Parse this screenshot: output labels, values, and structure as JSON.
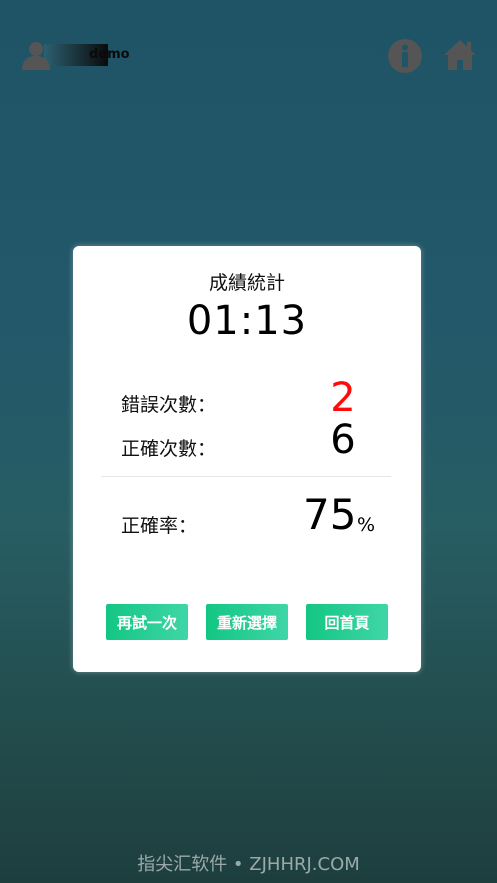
{
  "header": {
    "username": "demo",
    "user_icon": "user-icon",
    "info_icon": "info-icon",
    "home_icon": "home-icon"
  },
  "result_card": {
    "title": "成績統計",
    "time": "01:13",
    "wrong_label": "錯誤次數：",
    "wrong_count": "2",
    "correct_label": "正確次數：",
    "correct_count": "6",
    "rate_label": "正確率：",
    "rate_value": "75",
    "rate_unit": "%"
  },
  "buttons": {
    "retry": "再試一次",
    "reselect": "重新選擇",
    "home": "回首頁"
  },
  "watermark": "指尖汇软件 • ZJHHRJ.COM",
  "colors": {
    "wrong_value": "#ff0a0a",
    "button_gradient_start": "#13c683",
    "button_gradient_end": "#3fd6a7",
    "background_top": "#1e5466",
    "background_bottom": "#1e3e3e"
  }
}
